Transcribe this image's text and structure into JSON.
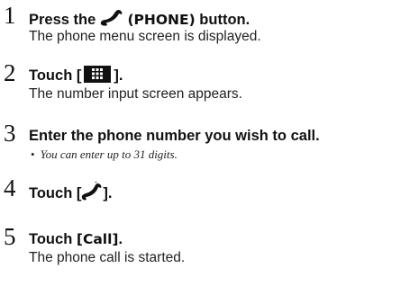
{
  "steps": [
    {
      "number": "1",
      "text_prefix": "Press the ",
      "icon": "phone-handset-icon",
      "text_suffix": "(PHONE)",
      "text_tail": " button.",
      "description": "The phone menu screen is displayed."
    },
    {
      "number": "2",
      "text_prefix": "Touch [",
      "icon": "keypad-icon",
      "text_suffix": "].",
      "description": "The number input screen appears."
    },
    {
      "number": "3",
      "text": "Enter the phone number you wish to call.",
      "note_bullet": "•",
      "note": "You can enter up to 31 digits."
    },
    {
      "number": "4",
      "text_prefix": "Touch [",
      "icon": "call-handset-icon",
      "text_suffix": "]."
    },
    {
      "number": "5",
      "text_prefix": "Touch ",
      "text_keyword": "[Call]",
      "text_suffix": ".",
      "description": "The phone call is started."
    }
  ]
}
